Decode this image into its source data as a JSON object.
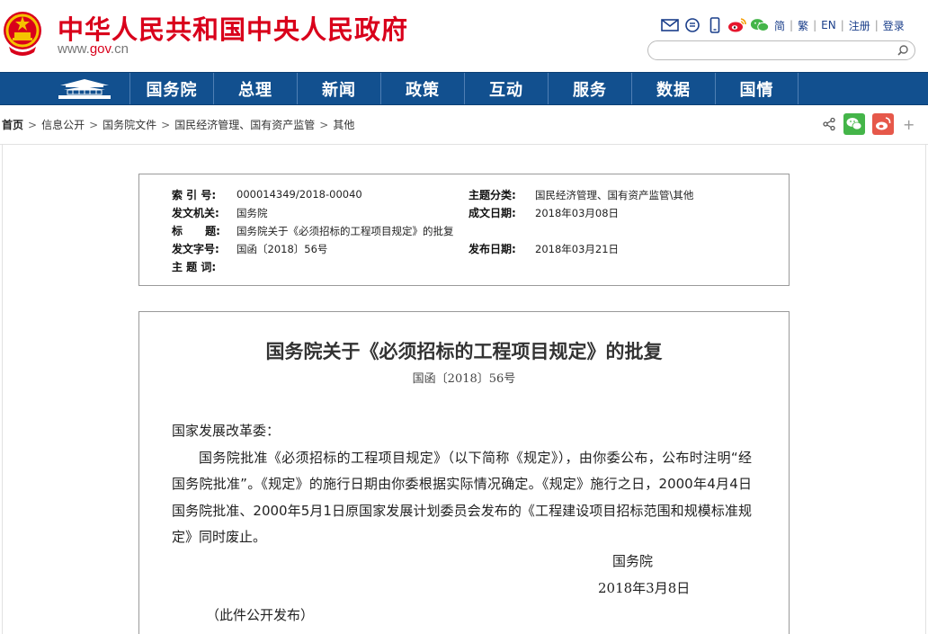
{
  "header": {
    "site_title": "中华人民共和国中央人民政府",
    "url_prefix": "www.",
    "url_brand": "gov",
    "url_suffix": ".cn",
    "links": [
      "简",
      "繁",
      "EN",
      "注册",
      "登录"
    ],
    "search_placeholder": ""
  },
  "nav": {
    "items": [
      "国务院",
      "总理",
      "新闻",
      "政策",
      "互动",
      "服务",
      "数据",
      "国情"
    ]
  },
  "breadcrumb": {
    "items": [
      "首页",
      "信息公开",
      "国务院文件",
      "国民经济管理、国有资产监管",
      "其他"
    ],
    "separator": ">"
  },
  "share": {
    "plus": "+"
  },
  "meta": {
    "index_label": "索 引 号:",
    "index_value": "000014349/2018-00040",
    "topic_label": "主题分类:",
    "topic_value": "国民经济管理、国有资产监管\\其他",
    "issuer_label": "发文机关:",
    "issuer_value": "国务院",
    "date_written_label": "成文日期:",
    "date_written_value": "2018年03月08日",
    "title_label": "标      题:",
    "title_value": "国务院关于《必须招标的工程项目规定》的批复",
    "docno_label": "发文字号:",
    "docno_value": "国函〔2018〕56号",
    "pubdate_label": "发布日期:",
    "pubdate_value": "2018年03月21日",
    "keywords_label": "主 题 词:",
    "keywords_value": ""
  },
  "article": {
    "title": "国务院关于《必须招标的工程项目规定》的批复",
    "doc_number": "国函〔2018〕56号",
    "salutation": "国家发展改革委：",
    "body": "国务院批准《必须招标的工程项目规定》（以下简称《规定》），由你委公布，公布时注明“经国务院批准”。《规定》的施行日期由你委根据实际情况确定。《规定》施行之日，2000年4月4日国务院批准、2000年5月1日原国家发展计划委员会发布的《工程建设项目招标范围和规模标准规定》同时废止。",
    "signer": "国务院",
    "sign_date": "2018年3月8日",
    "publish_note": "（此件公开发布）"
  },
  "colors": {
    "brand_red": "#d9001b",
    "nav_blue": "#12508f",
    "link_blue": "#1a3e8a",
    "wechat_green": "#44b549",
    "weibo_red": "#e6584a"
  }
}
